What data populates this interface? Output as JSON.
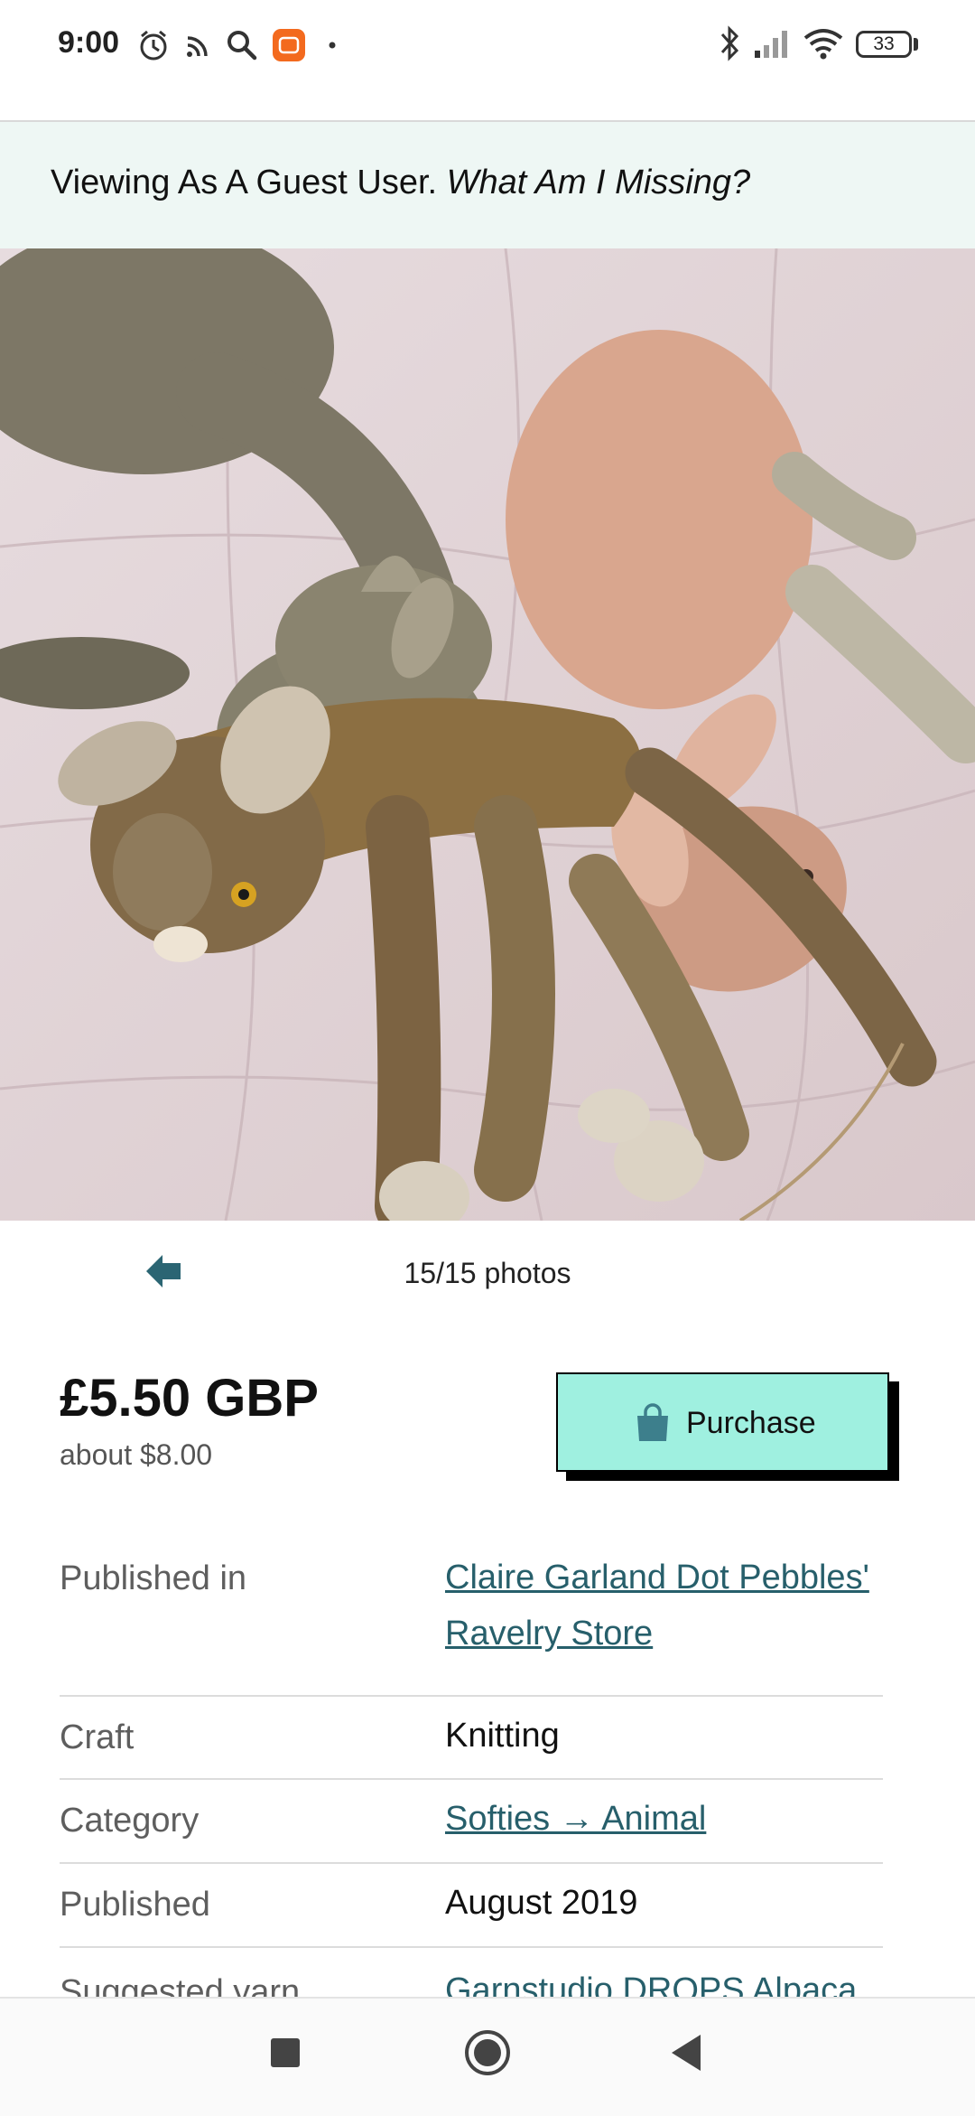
{
  "status_bar": {
    "time": "9:00",
    "battery": "33"
  },
  "banner": {
    "text": "Viewing As A Guest User. ",
    "link": "What Am I Missing?"
  },
  "gallery": {
    "count": "15/15 photos"
  },
  "pricing": {
    "price": "£5.50 GBP",
    "approx": "about $8.00",
    "purchase_label": "Purchase"
  },
  "details": [
    {
      "label": "Published in",
      "value": "Claire Garland Dot Pebbles' Ravelry Store",
      "link": true
    },
    {
      "label": "Craft",
      "value": "Knitting",
      "link": false
    },
    {
      "label": "Category",
      "value": "Softies → Animal",
      "link": true
    },
    {
      "label": "Published",
      "value": "August 2019",
      "link": false
    },
    {
      "label": "Suggested yarn",
      "value": "Garnstudio DROPS Alpaca",
      "link": true
    }
  ],
  "colors": {
    "accent": "#9ff0e0",
    "link": "#275f6b",
    "banner_bg": "#eef7f4"
  }
}
